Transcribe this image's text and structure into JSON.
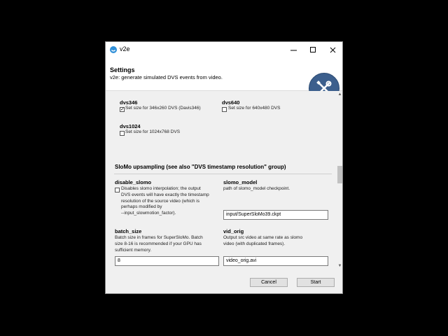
{
  "window": {
    "title": "v2e"
  },
  "header": {
    "title": "Settings",
    "subtitle": "v2e: generate simulated DVS events from video."
  },
  "dvs": {
    "dvs346": {
      "label": "dvs346",
      "checkbox_text": "Set size for 346x260 DVS (Davis346)",
      "checked": true
    },
    "dvs640": {
      "label": "dvs640",
      "checkbox_text": "Set size for 640x480 DVS",
      "checked": false
    },
    "dvs1024": {
      "label": "dvs1024",
      "checkbox_text": "Set size for 1024x768 DVS",
      "checked": false
    }
  },
  "slomo": {
    "section_title": "SloMo upsampling (see also \"DVS timestamp resolution\" group)",
    "disable_slomo": {
      "label": "disable_slomo",
      "text_lines": [
        "Disables slomo interpolation; the output",
        "DVS events will have exactly the timestamp",
        "resolution of the source video (which is",
        "perhaps modified by",
        "--input_slowmotion_factor)."
      ],
      "checked": false
    },
    "slomo_model": {
      "label": "slomo_model",
      "desc": "path of slomo_model checkpoint.",
      "value": "input/SuperSloMo39.ckpt"
    },
    "batch_size": {
      "label": "batch_size",
      "desc_lines": [
        "Batch size in frames for SuperSloMo. Batch",
        "size 8-16 is recommended if your GPU has",
        "sufficient memory."
      ],
      "value": "8"
    },
    "vid_orig": {
      "label": "vid_orig",
      "desc_lines": [
        "Output src video at same rate as slomo",
        "video (with duplicated frames)."
      ],
      "value": "video_orig.avi"
    }
  },
  "footer": {
    "cancel_label": "Cancel",
    "start_label": "Start"
  }
}
